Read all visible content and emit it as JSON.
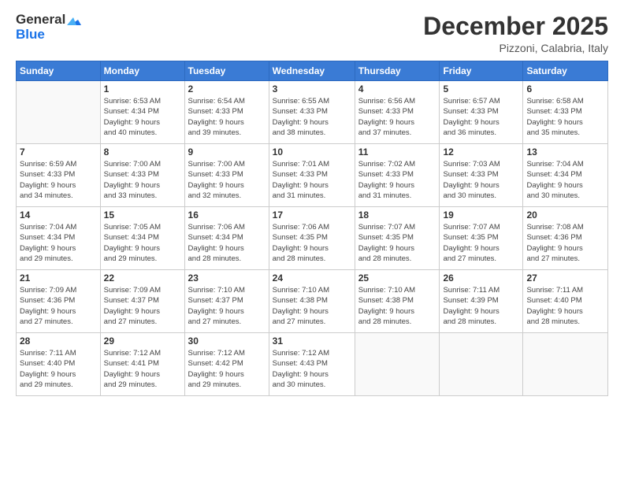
{
  "logo": {
    "general": "General",
    "blue": "Blue"
  },
  "title": "December 2025",
  "location": "Pizzoni, Calabria, Italy",
  "days_header": [
    "Sunday",
    "Monday",
    "Tuesday",
    "Wednesday",
    "Thursday",
    "Friday",
    "Saturday"
  ],
  "weeks": [
    [
      {
        "day": "",
        "info": ""
      },
      {
        "day": "1",
        "info": "Sunrise: 6:53 AM\nSunset: 4:34 PM\nDaylight: 9 hours\nand 40 minutes."
      },
      {
        "day": "2",
        "info": "Sunrise: 6:54 AM\nSunset: 4:33 PM\nDaylight: 9 hours\nand 39 minutes."
      },
      {
        "day": "3",
        "info": "Sunrise: 6:55 AM\nSunset: 4:33 PM\nDaylight: 9 hours\nand 38 minutes."
      },
      {
        "day": "4",
        "info": "Sunrise: 6:56 AM\nSunset: 4:33 PM\nDaylight: 9 hours\nand 37 minutes."
      },
      {
        "day": "5",
        "info": "Sunrise: 6:57 AM\nSunset: 4:33 PM\nDaylight: 9 hours\nand 36 minutes."
      },
      {
        "day": "6",
        "info": "Sunrise: 6:58 AM\nSunset: 4:33 PM\nDaylight: 9 hours\nand 35 minutes."
      }
    ],
    [
      {
        "day": "7",
        "info": "Sunrise: 6:59 AM\nSunset: 4:33 PM\nDaylight: 9 hours\nand 34 minutes."
      },
      {
        "day": "8",
        "info": "Sunrise: 7:00 AM\nSunset: 4:33 PM\nDaylight: 9 hours\nand 33 minutes."
      },
      {
        "day": "9",
        "info": "Sunrise: 7:00 AM\nSunset: 4:33 PM\nDaylight: 9 hours\nand 32 minutes."
      },
      {
        "day": "10",
        "info": "Sunrise: 7:01 AM\nSunset: 4:33 PM\nDaylight: 9 hours\nand 31 minutes."
      },
      {
        "day": "11",
        "info": "Sunrise: 7:02 AM\nSunset: 4:33 PM\nDaylight: 9 hours\nand 31 minutes."
      },
      {
        "day": "12",
        "info": "Sunrise: 7:03 AM\nSunset: 4:33 PM\nDaylight: 9 hours\nand 30 minutes."
      },
      {
        "day": "13",
        "info": "Sunrise: 7:04 AM\nSunset: 4:34 PM\nDaylight: 9 hours\nand 30 minutes."
      }
    ],
    [
      {
        "day": "14",
        "info": "Sunrise: 7:04 AM\nSunset: 4:34 PM\nDaylight: 9 hours\nand 29 minutes."
      },
      {
        "day": "15",
        "info": "Sunrise: 7:05 AM\nSunset: 4:34 PM\nDaylight: 9 hours\nand 29 minutes."
      },
      {
        "day": "16",
        "info": "Sunrise: 7:06 AM\nSunset: 4:34 PM\nDaylight: 9 hours\nand 28 minutes."
      },
      {
        "day": "17",
        "info": "Sunrise: 7:06 AM\nSunset: 4:35 PM\nDaylight: 9 hours\nand 28 minutes."
      },
      {
        "day": "18",
        "info": "Sunrise: 7:07 AM\nSunset: 4:35 PM\nDaylight: 9 hours\nand 28 minutes."
      },
      {
        "day": "19",
        "info": "Sunrise: 7:07 AM\nSunset: 4:35 PM\nDaylight: 9 hours\nand 27 minutes."
      },
      {
        "day": "20",
        "info": "Sunrise: 7:08 AM\nSunset: 4:36 PM\nDaylight: 9 hours\nand 27 minutes."
      }
    ],
    [
      {
        "day": "21",
        "info": "Sunrise: 7:09 AM\nSunset: 4:36 PM\nDaylight: 9 hours\nand 27 minutes."
      },
      {
        "day": "22",
        "info": "Sunrise: 7:09 AM\nSunset: 4:37 PM\nDaylight: 9 hours\nand 27 minutes."
      },
      {
        "day": "23",
        "info": "Sunrise: 7:10 AM\nSunset: 4:37 PM\nDaylight: 9 hours\nand 27 minutes."
      },
      {
        "day": "24",
        "info": "Sunrise: 7:10 AM\nSunset: 4:38 PM\nDaylight: 9 hours\nand 27 minutes."
      },
      {
        "day": "25",
        "info": "Sunrise: 7:10 AM\nSunset: 4:38 PM\nDaylight: 9 hours\nand 28 minutes."
      },
      {
        "day": "26",
        "info": "Sunrise: 7:11 AM\nSunset: 4:39 PM\nDaylight: 9 hours\nand 28 minutes."
      },
      {
        "day": "27",
        "info": "Sunrise: 7:11 AM\nSunset: 4:40 PM\nDaylight: 9 hours\nand 28 minutes."
      }
    ],
    [
      {
        "day": "28",
        "info": "Sunrise: 7:11 AM\nSunset: 4:40 PM\nDaylight: 9 hours\nand 29 minutes."
      },
      {
        "day": "29",
        "info": "Sunrise: 7:12 AM\nSunset: 4:41 PM\nDaylight: 9 hours\nand 29 minutes."
      },
      {
        "day": "30",
        "info": "Sunrise: 7:12 AM\nSunset: 4:42 PM\nDaylight: 9 hours\nand 29 minutes."
      },
      {
        "day": "31",
        "info": "Sunrise: 7:12 AM\nSunset: 4:43 PM\nDaylight: 9 hours\nand 30 minutes."
      },
      {
        "day": "",
        "info": ""
      },
      {
        "day": "",
        "info": ""
      },
      {
        "day": "",
        "info": ""
      }
    ]
  ]
}
